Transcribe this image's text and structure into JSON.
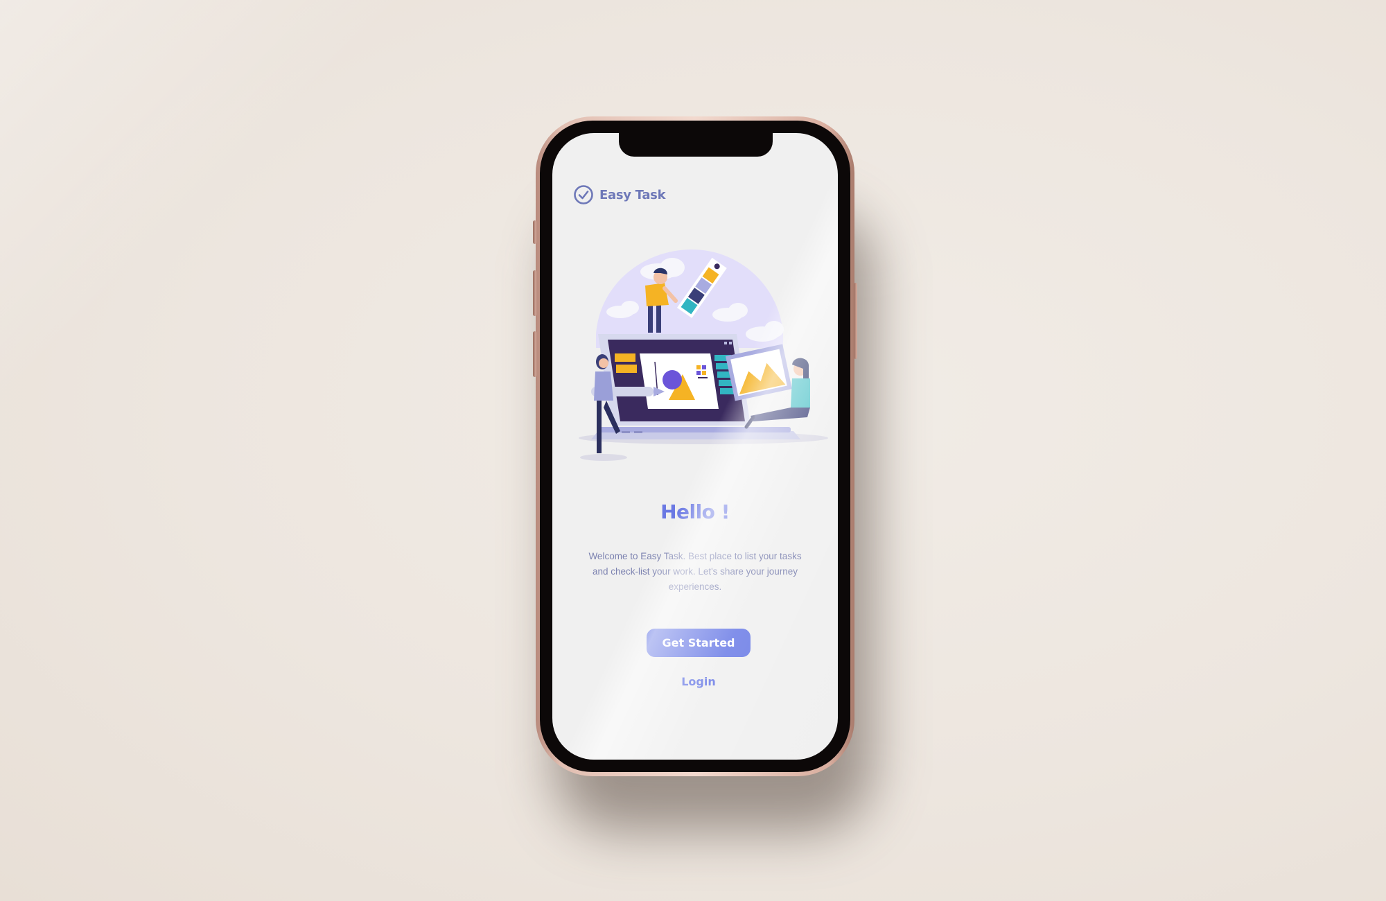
{
  "app": {
    "name": "Easy Task"
  },
  "welcome_screen": {
    "heading": "Hello !",
    "description": "Welcome to Easy Task. Best place to list your tasks and check-list your work. Let's share your journey experiences.",
    "primary_button_label": "Get Started",
    "secondary_link_label": "Login"
  },
  "icons": {
    "logo": "check-circle-icon"
  },
  "colors": {
    "accent": "#6b7ce6",
    "logo_text": "#6e78b8",
    "body_text": "#7c82b0",
    "screen_background": "#f0f0f0",
    "page_background": "#ede6df",
    "phone_frame": "#e2bfb2"
  }
}
